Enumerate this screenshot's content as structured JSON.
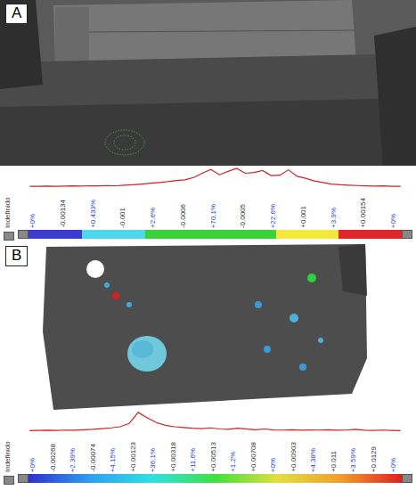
{
  "panels": [
    {
      "letter": "A",
      "histogram": {
        "left_label": "Indefinido",
        "ticks": [
          {
            "text": "+0%",
            "kind": "percent"
          },
          {
            "text": "-0.00134",
            "kind": "value"
          },
          {
            "text": "+0.433%",
            "kind": "percent"
          },
          {
            "text": "-0.001",
            "kind": "value"
          },
          {
            "text": "+2.6%",
            "kind": "percent"
          },
          {
            "text": "-0.0006",
            "kind": "value"
          },
          {
            "text": "+70.1%",
            "kind": "percent"
          },
          {
            "text": "-0.0005",
            "kind": "value"
          },
          {
            "text": "+22.6%",
            "kind": "percent"
          },
          {
            "text": "+0.001",
            "kind": "value"
          },
          {
            "text": "+3.9%",
            "kind": "percent"
          },
          {
            "text": "+0.00154",
            "kind": "value"
          },
          {
            "text": "+0%",
            "kind": "percent"
          }
        ],
        "series": [
          2,
          2,
          3,
          2,
          3,
          4,
          3,
          5,
          4,
          6,
          5,
          8,
          10,
          14,
          18,
          22,
          26,
          32,
          36,
          48,
          70,
          90,
          62,
          80,
          96,
          70,
          74,
          84,
          58,
          60,
          88,
          54,
          44,
          30,
          22,
          14,
          10,
          8,
          6,
          4,
          3,
          4,
          2,
          2
        ],
        "scale": {
          "kind": "segments",
          "colors": [
            "#3b3bd6",
            "#4fd8ec",
            "#3bd13b",
            "#f2e93a",
            "#e8222a"
          ]
        }
      }
    },
    {
      "letter": "B",
      "histogram": {
        "left_label": "Indefinido",
        "ticks": [
          {
            "text": "+0%",
            "kind": "percent"
          },
          {
            "text": "-0.00268",
            "kind": "value"
          },
          {
            "text": "+2.39%",
            "kind": "percent"
          },
          {
            "text": "-0.00074",
            "kind": "value"
          },
          {
            "text": "+4.15%",
            "kind": "percent"
          },
          {
            "text": "+0.00123",
            "kind": "value"
          },
          {
            "text": "+36.1%",
            "kind": "percent"
          },
          {
            "text": "+0.00318",
            "kind": "value"
          },
          {
            "text": "+11.6%",
            "kind": "percent"
          },
          {
            "text": "+0.00513",
            "kind": "value"
          },
          {
            "text": "+1.2%",
            "kind": "percent"
          },
          {
            "text": "+0.00708",
            "kind": "value"
          },
          {
            "text": "+0%",
            "kind": "percent"
          },
          {
            "text": "+0.00903",
            "kind": "value"
          },
          {
            "text": "+4.38%",
            "kind": "percent"
          },
          {
            "text": "+0.011",
            "kind": "value"
          },
          {
            "text": "+3.59%",
            "kind": "percent"
          },
          {
            "text": "+0.0129",
            "kind": "value"
          },
          {
            "text": "+0%",
            "kind": "percent"
          }
        ],
        "series": [
          1,
          2,
          3,
          2,
          4,
          3,
          6,
          8,
          12,
          16,
          22,
          40,
          100,
          70,
          45,
          30,
          22,
          18,
          14,
          12,
          16,
          10,
          8,
          14,
          9,
          6,
          10,
          5,
          4,
          6,
          3,
          5,
          4,
          6,
          3,
          4,
          8,
          3,
          2,
          4,
          2,
          1
        ],
        "scale": {
          "kind": "gradient",
          "colors": [
            "#3030d0",
            "#30a0f0",
            "#30e0e0",
            "#40e040",
            "#e0e040",
            "#f0a030",
            "#e02020"
          ]
        }
      }
    }
  ]
}
